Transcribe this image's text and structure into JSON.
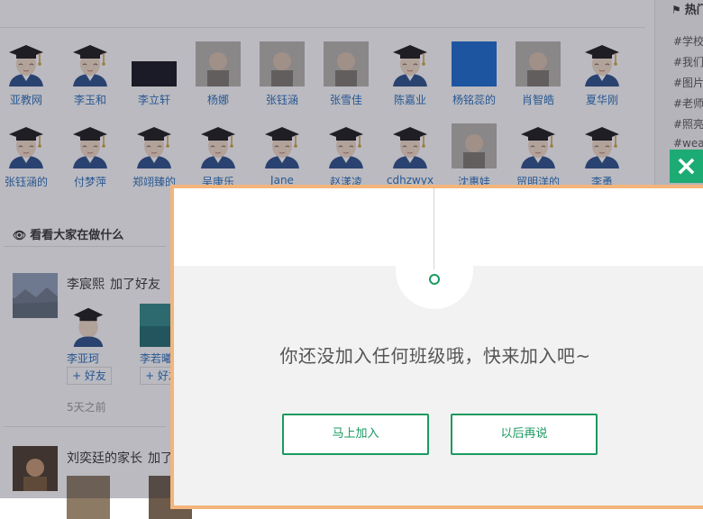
{
  "colors": {
    "accent_green": "#1a9a60",
    "close_green": "#1cab73",
    "modal_border": "#f3b57b",
    "link_blue": "#2a6ebb"
  },
  "friends": {
    "row1": [
      {
        "name": "亚教网",
        "avatar": "graduate-avatar"
      },
      {
        "name": "李玉和",
        "avatar": "graduate-avatar"
      },
      {
        "name": "李立轩",
        "avatar": "dark-photo"
      },
      {
        "name": "杨娜",
        "avatar": "photo"
      },
      {
        "name": "张钰涵",
        "avatar": "photo"
      },
      {
        "name": "张雪佳",
        "avatar": "photo"
      },
      {
        "name": "陈嘉业",
        "avatar": "graduate-avatar"
      },
      {
        "name": "杨铭蕊的",
        "avatar": "blue-photo"
      },
      {
        "name": "肖智皓",
        "avatar": "photo"
      },
      {
        "name": "夏华刚",
        "avatar": "graduate-avatar"
      }
    ],
    "row2": [
      {
        "name": "张钰涵的",
        "avatar": "graduate-avatar"
      },
      {
        "name": "付梦萍",
        "avatar": "graduate-avatar"
      },
      {
        "name": "郑翊臻的",
        "avatar": "graduate-avatar"
      },
      {
        "name": "吴康乐",
        "avatar": "graduate-avatar"
      },
      {
        "name": "Jane",
        "avatar": "graduate-avatar"
      },
      {
        "name": "赵漾凌",
        "avatar": "graduate-avatar"
      },
      {
        "name": "cdhzwyx",
        "avatar": "graduate-avatar"
      },
      {
        "name": "沈惠娃",
        "avatar": "photo"
      },
      {
        "name": "贸明洋的",
        "avatar": "graduate-avatar"
      },
      {
        "name": "李勇",
        "avatar": "graduate-avatar"
      }
    ]
  },
  "activity": {
    "title": "看看大家在做什么",
    "feed": [
      {
        "user": "李宸熙",
        "action": "加了好友",
        "added": [
          {
            "name": "李亚珂",
            "button": "+ 好友"
          },
          {
            "name": "李若曦",
            "button": "+ 好友"
          }
        ],
        "time": "5天之前"
      },
      {
        "user": "刘奕廷的家长",
        "action": "加了"
      }
    ]
  },
  "sidebar": {
    "title": "热门",
    "tags": [
      "#学校",
      "#我们",
      "#图片",
      "#老师",
      "#照亮",
      "#wea"
    ]
  },
  "modal": {
    "message": "你还没加入任何班级哦，快来加入吧~",
    "join_button": "马上加入",
    "later_button": "以后再说",
    "close_icon": "×"
  }
}
